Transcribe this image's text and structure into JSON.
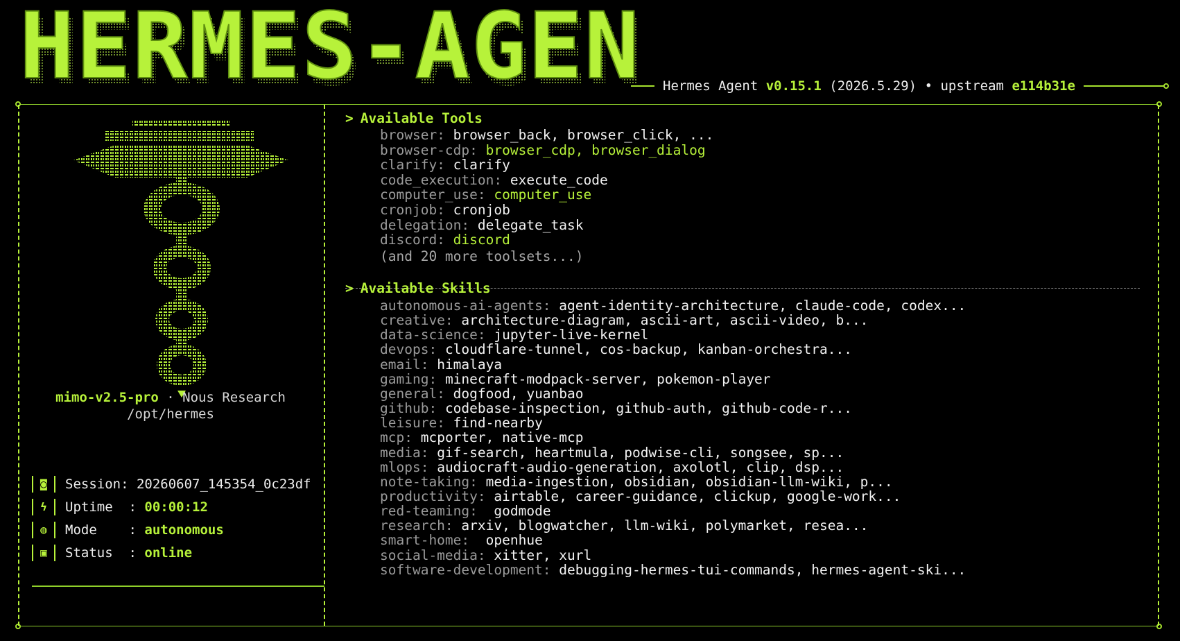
{
  "banner": {
    "title": "HERMES-AGENT",
    "product": "Hermes Agent",
    "version": "v0.15.1",
    "build_date": "(2026.5.29)",
    "bullet": "•",
    "upstream_label": "upstream",
    "upstream_hash": "e114b31e"
  },
  "profile": {
    "model": "mimo-v2.5-pro",
    "separator": "·",
    "provider": "Nous Research",
    "path": "/opt/hermes"
  },
  "info": [
    {
      "icon": "session-icon",
      "glyph": "◙",
      "label": "Session:",
      "value": "20260607_145354_0c23df",
      "highlight": false
    },
    {
      "icon": "lightning-icon",
      "glyph": "ϟ",
      "label": "Uptime  :",
      "value": "00:00:12",
      "highlight": true
    },
    {
      "icon": "brain-icon",
      "glyph": "◍",
      "label": "Mode    :",
      "value": "autonomous",
      "highlight": true
    },
    {
      "icon": "status-icon",
      "glyph": "▣",
      "label": "Status  :",
      "value": "online",
      "highlight": true
    }
  ],
  "tools": {
    "chevron": ">",
    "title": "Available Tools",
    "items": [
      {
        "category": "browser:",
        "value": "browser_back, browser_click, ...",
        "green": false
      },
      {
        "category": "browser-cdp:",
        "value": "browser_cdp, browser_dialog",
        "green": true
      },
      {
        "category": "clarify:",
        "value": "clarify",
        "green": false
      },
      {
        "category": "code_execution:",
        "value": "execute_code",
        "green": false
      },
      {
        "category": "computer_use:",
        "value": "computer_use",
        "green": true
      },
      {
        "category": "cronjob:",
        "value": "cronjob",
        "green": false
      },
      {
        "category": "delegation:",
        "value": "delegate_task",
        "green": false
      },
      {
        "category": "discord:",
        "value": "discord",
        "green": true
      }
    ],
    "more": "(and 20 more toolsets...)"
  },
  "skills": {
    "chevron": ">",
    "title": "Available Skills",
    "items": [
      {
        "category": "autonomous-ai-agents:",
        "value": "agent-identity-architecture, claude-code, codex..."
      },
      {
        "category": "creative:",
        "value": "architecture-diagram, ascii-art, ascii-video, b..."
      },
      {
        "category": "data-science:",
        "value": "jupyter-live-kernel"
      },
      {
        "category": "devops:",
        "value": "cloudflare-tunnel, cos-backup, kanban-orchestra..."
      },
      {
        "category": "email:",
        "value": "himalaya"
      },
      {
        "category": "gaming:",
        "value": "minecraft-modpack-server, pokemon-player"
      },
      {
        "category": "general:",
        "value": "dogfood, yuanbao"
      },
      {
        "category": "github:",
        "value": "codebase-inspection, github-auth, github-code-r..."
      },
      {
        "category": "leisure:",
        "value": "find-nearby"
      },
      {
        "category": "mcp:",
        "value": "mcporter, native-mcp"
      },
      {
        "category": "media:",
        "value": "gif-search, heartmula, podwise-cli, songsee, sp..."
      },
      {
        "category": "mlops:",
        "value": "audiocraft-audio-generation, axolotl, clip, dsp..."
      },
      {
        "category": "note-taking:",
        "value": "media-ingestion, obsidian, obsidian-llm-wiki, p..."
      },
      {
        "category": "productivity:",
        "value": "airtable, career-guidance, clickup, google-work..."
      },
      {
        "category": "red-teaming:",
        "value": " godmode"
      },
      {
        "category": "research:",
        "value": "arxiv, blogwatcher, llm-wiki, polymarket, resea..."
      },
      {
        "category": "smart-home:",
        "value": " openhue"
      },
      {
        "category": "social-media:",
        "value": "xitter, xurl"
      },
      {
        "category": "software-development:",
        "value": "debugging-hermes-tui-commands, hermes-agent-ski..."
      }
    ]
  },
  "colors": {
    "accent": "#b7f23a",
    "background": "#000000",
    "muted": "#9a9a9a"
  }
}
